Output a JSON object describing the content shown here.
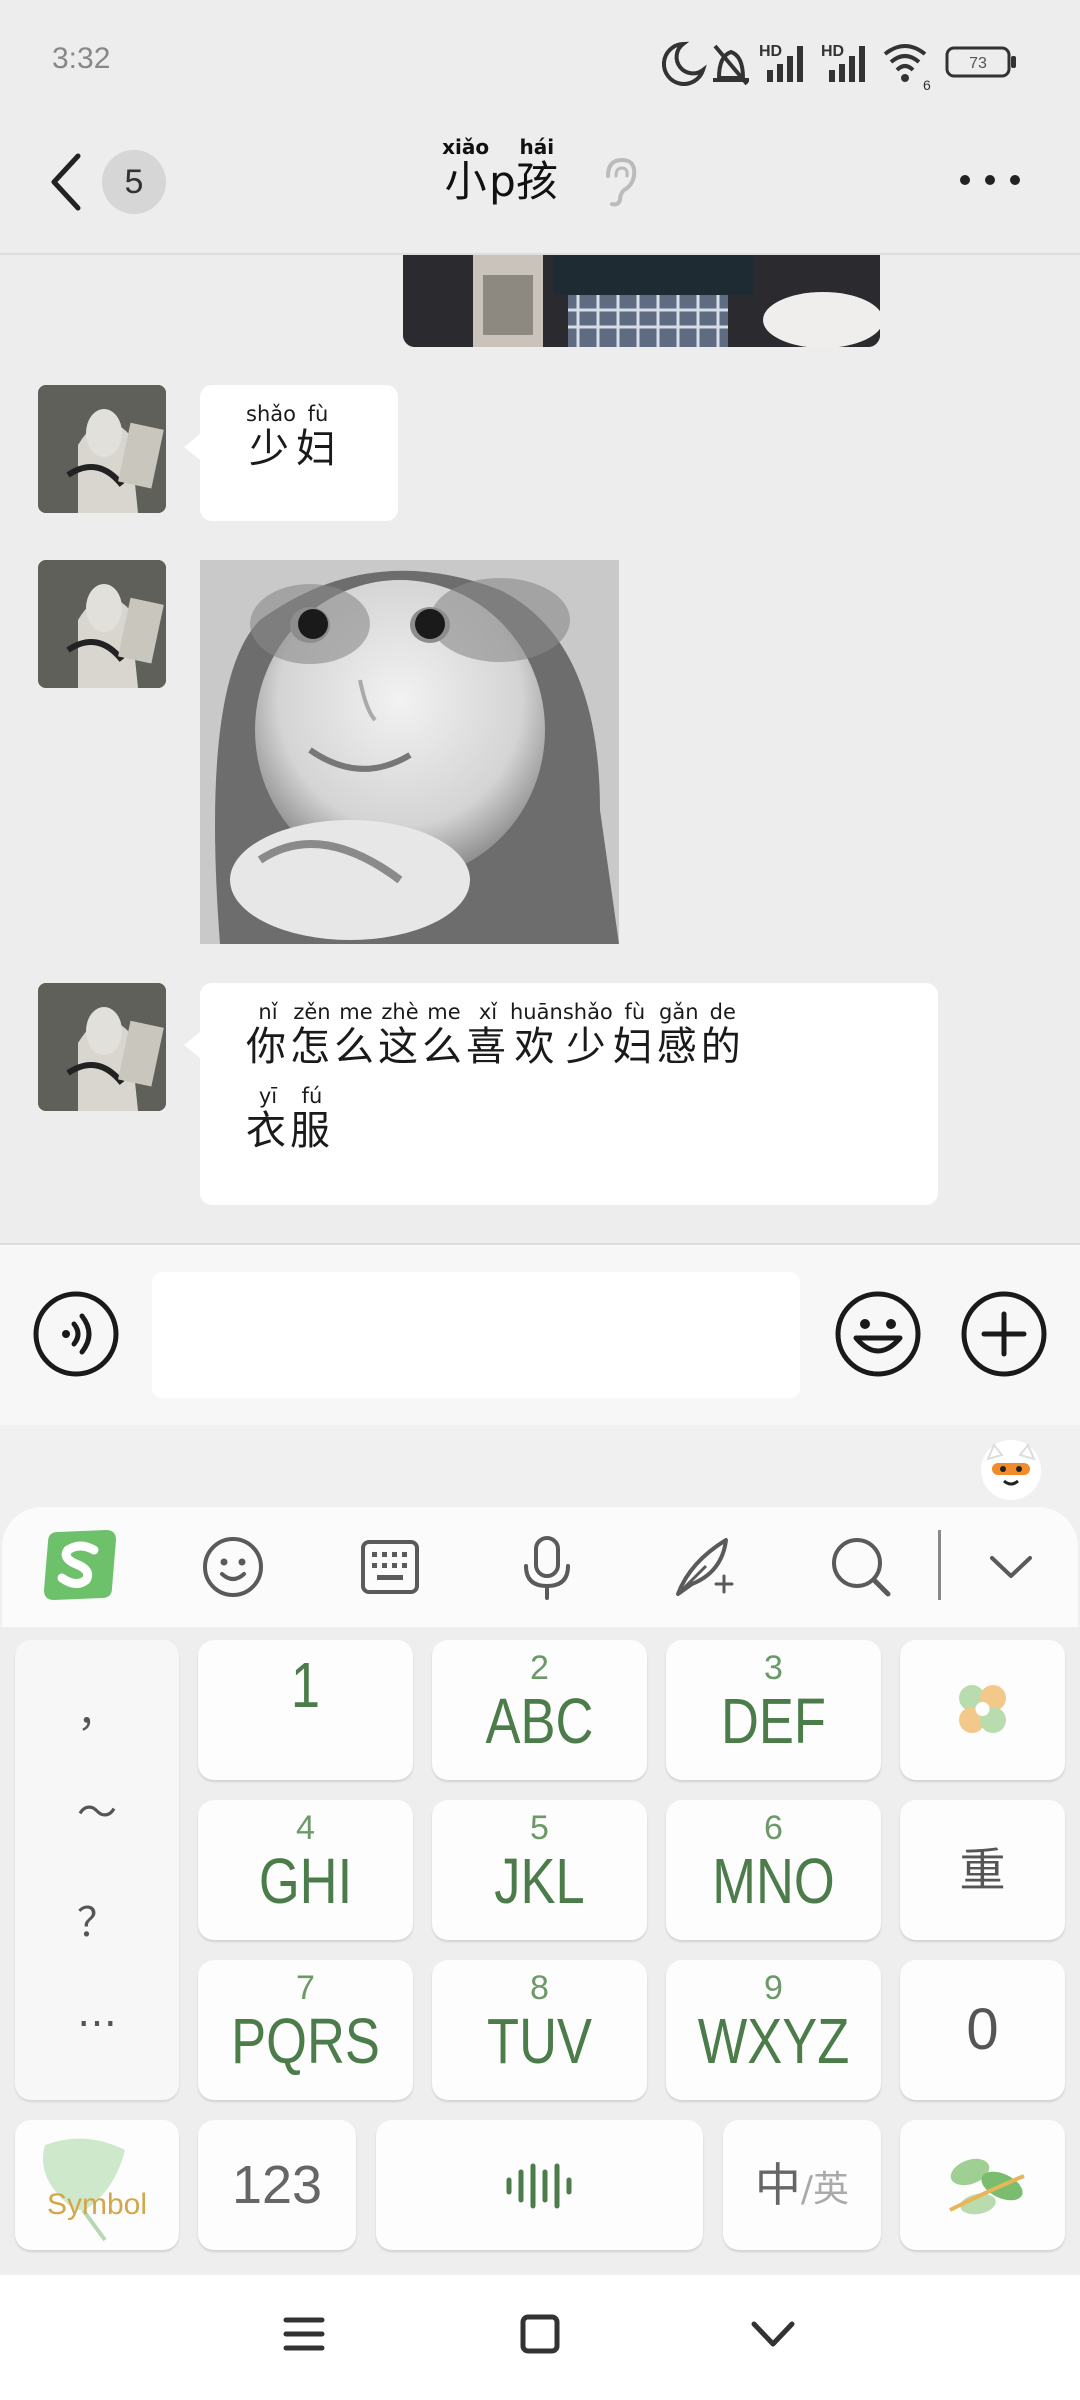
{
  "status_bar": {
    "time": "3:32",
    "signal_1_label": "HD",
    "signal_2_label": "HD",
    "wifi_label": "6",
    "battery": "73"
  },
  "header": {
    "unread_count": "5",
    "title_chars": [
      {
        "char": "小",
        "pinyin": "xiǎo"
      },
      {
        "char": "p",
        "pinyin": ""
      },
      {
        "char": "孩",
        "pinyin": "hái"
      }
    ]
  },
  "messages": [
    {
      "type": "text",
      "chars": [
        {
          "char": "少",
          "pinyin": "shǎo"
        },
        {
          "char": "妇",
          "pinyin": "fù"
        }
      ]
    },
    {
      "type": "sticker"
    },
    {
      "type": "text",
      "line1": [
        {
          "char": "你",
          "pinyin": "nǐ"
        },
        {
          "char": "怎",
          "pinyin": "zěn"
        },
        {
          "char": "么",
          "pinyin": "me"
        },
        {
          "char": "这",
          "pinyin": "zhè"
        },
        {
          "char": "么",
          "pinyin": "me"
        },
        {
          "char": "喜",
          "pinyin": "xǐ"
        },
        {
          "char": "欢",
          "pinyin": "huān"
        },
        {
          "char": "少",
          "pinyin": "shǎo"
        },
        {
          "char": "妇",
          "pinyin": "fù"
        },
        {
          "char": "感",
          "pinyin": "gǎn"
        },
        {
          "char": "的",
          "pinyin": "de"
        }
      ],
      "line2": [
        {
          "char": "衣",
          "pinyin": "yī"
        },
        {
          "char": "服",
          "pinyin": "fú"
        }
      ]
    }
  ],
  "input": {
    "value": "",
    "placeholder": ""
  },
  "keyboard": {
    "punctuation": [
      "，",
      "～",
      "？",
      "…"
    ],
    "keys": [
      {
        "num": "",
        "letters": "1"
      },
      {
        "num": "2",
        "letters": "ABC"
      },
      {
        "num": "3",
        "letters": "DEF"
      },
      {
        "num": "4",
        "letters": "GHI"
      },
      {
        "num": "5",
        "letters": "JKL"
      },
      {
        "num": "6",
        "letters": "MNO"
      },
      {
        "num": "7",
        "letters": "PQRS"
      },
      {
        "num": "8",
        "letters": "TUV"
      },
      {
        "num": "9",
        "letters": "WXYZ"
      }
    ],
    "reenter_key": "重",
    "zero_key": "0",
    "symbol_key": "Symbol",
    "num_key": "123",
    "lang_key_main": "中",
    "lang_key_alt": "/英"
  },
  "colors": {
    "accent_green": "#4d7c4b",
    "logo_green": "#6cc16a",
    "bubble": "#ffffff",
    "background": "#ededed"
  },
  "icons": [
    "back-icon",
    "ear-icon",
    "more-icon",
    "voice-icon",
    "emoji-icon",
    "plus-icon",
    "sogou-logo-icon",
    "smiley-icon",
    "keyboard-icon",
    "microphone-icon",
    "quill-icon",
    "search-icon",
    "collapse-chevron-icon",
    "clover-icon",
    "sound-wave-icon",
    "leaf-icon",
    "menu-icon",
    "home-icon",
    "back-chevron-icon"
  ]
}
